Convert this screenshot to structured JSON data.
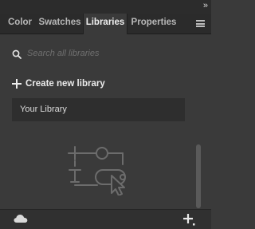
{
  "window": {
    "collapse_glyph": "»"
  },
  "tabs": [
    {
      "label": "Color",
      "active": false
    },
    {
      "label": "Swatches",
      "active": false
    },
    {
      "label": "Libraries",
      "active": true
    },
    {
      "label": "Properties",
      "active": false
    }
  ],
  "search": {
    "placeholder": "Search all libraries",
    "value": "",
    "icon": "search-icon"
  },
  "actions": {
    "create_label": "Create new library",
    "create_icon": "plus-icon"
  },
  "libraries": [
    {
      "name": "Your Library"
    }
  ],
  "empty_state": {
    "illustration": "library-assets-illustration"
  },
  "footer": {
    "cloud_icon": "cloud-icon",
    "add_icon": "add-plus-icon"
  },
  "colors": {
    "panel_bg": "#3a3a3a",
    "tabbar_bg": "#2b2b2b",
    "active_tab_bg": "#3a3a3a",
    "item_bg": "#2e2e2e",
    "text_primary": "#ececec",
    "text_muted": "#b7b7b7",
    "placeholder": "#6f6f6f"
  }
}
